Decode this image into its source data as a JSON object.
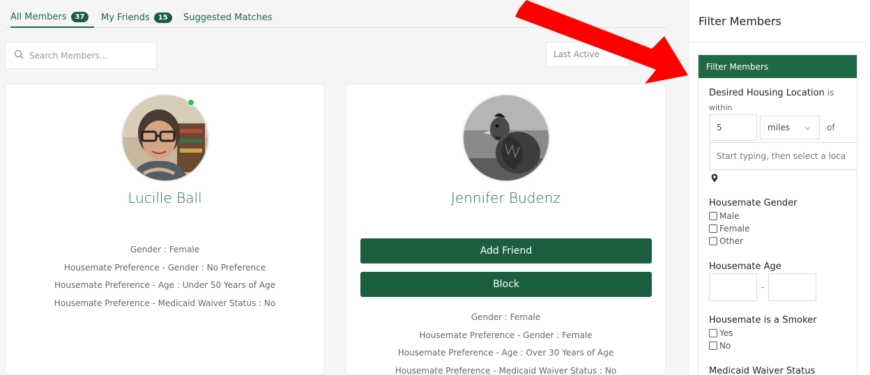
{
  "tabs": [
    {
      "label": "All Members",
      "count": "37"
    },
    {
      "label": "My Friends",
      "count": "15"
    },
    {
      "label": "Suggested Matches"
    }
  ],
  "search": {
    "placeholder": "Search Members..."
  },
  "sort": {
    "value": "Last Active"
  },
  "members": [
    {
      "name": "Lucille Ball",
      "online": true,
      "info": [
        "Gender : Female",
        "Housemate Preference - Gender : No Preference",
        "Housemate Preference - Age : Under 50 Years of Age",
        "Housemate Preference - Medicaid Waiver Status : No"
      ]
    },
    {
      "name": "Jennifer Budenz",
      "add_friend_label": "Add Friend",
      "block_label": "Block",
      "info": [
        "Gender : Female",
        "Housemate Preference - Gender : Female",
        "Housemate Preference - Age : Over 30 Years of Age",
        "Housemate Preference - Medicaid Waiver Status : No"
      ]
    }
  ],
  "sidebar": {
    "title": "Filter Members",
    "panel_title": "Filter Members",
    "location_label_bold": "Desired Housing Location",
    "location_label_rest": " is",
    "location_label_within": "within",
    "distance_value": "5",
    "unit_value": "miles",
    "of_label": "of",
    "location_placeholder": "Start typing, then select a loca",
    "gender_label": "Housemate Gender",
    "gender_options": [
      "Male",
      "Female",
      "Other"
    ],
    "age_label": "Housemate Age",
    "age_separator": "-",
    "smoker_label": "Housemate is a Smoker",
    "smoker_options": [
      "Yes",
      "No"
    ],
    "medicaid_label": "Medicaid Waiver Status"
  },
  "colors": {
    "accent": "#1d6a45",
    "button": "#1a5d3f",
    "online": "#22c55e",
    "annotation_arrow": "#ff0000"
  }
}
